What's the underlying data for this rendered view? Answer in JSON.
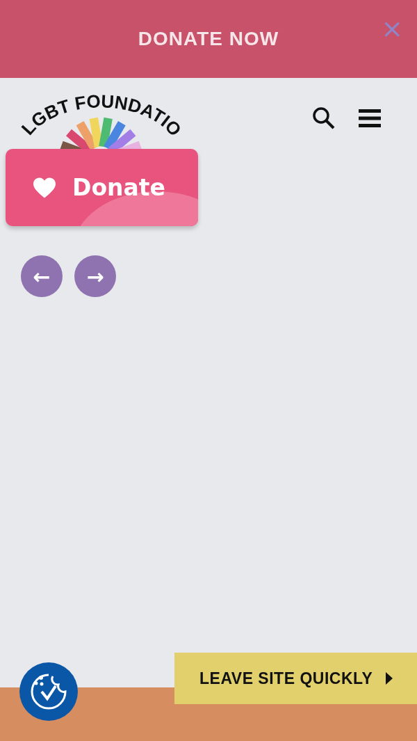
{
  "banner": {
    "title": "DONATE NOW",
    "close": "×"
  },
  "logo": {
    "text": "LGBT FOUNDATIO"
  },
  "donate_button": {
    "label": "Donate"
  },
  "carousel": {
    "previous": "←",
    "next": "→"
  },
  "leave_button": {
    "label": "LEAVE SITE QUICKLY"
  }
}
